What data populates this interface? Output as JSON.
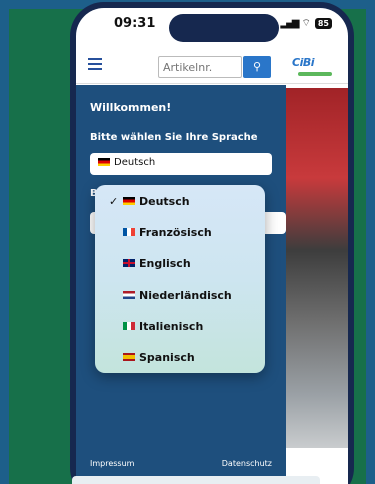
{
  "status_bar": {
    "time": "09:31",
    "battery": "85"
  },
  "header": {
    "search_placeholder": "Artikelnr."
  },
  "logo": {
    "text": "CiBi"
  },
  "sidebar": {
    "welcome": "Willkommen!",
    "language_label": "Bitte wählen Sie Ihre Sprache",
    "language_selected": "Deutsch",
    "second_label_partial": "Bi",
    "second_select_partial": "I",
    "footer_left": "Impressum",
    "footer_right": "Datenschutz"
  },
  "dropdown": {
    "options": [
      {
        "label": "Deutsch",
        "flag": "de",
        "selected": true
      },
      {
        "label": "Französisch",
        "flag": "fr",
        "selected": false
      },
      {
        "label": "Englisch",
        "flag": "gb",
        "selected": false
      },
      {
        "label": "Niederländisch",
        "flag": "nl",
        "selected": false
      },
      {
        "label": "Italienisch",
        "flag": "it",
        "selected": false
      },
      {
        "label": "Spanisch",
        "flag": "es",
        "selected": false
      }
    ]
  },
  "colors": {
    "background": "#17704a",
    "sidebar": "#1e4f7d",
    "accent": "#2a76c9",
    "phone": "#16284f"
  }
}
